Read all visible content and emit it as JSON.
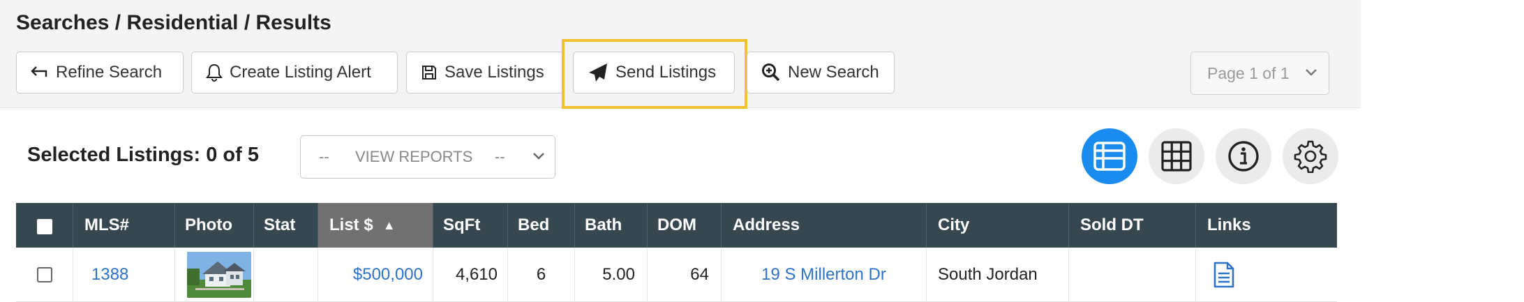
{
  "header": {
    "breadcrumb": "Searches / Residential / Results"
  },
  "toolbar": {
    "refine_label": "Refine Search",
    "alert_label": "Create Listing Alert",
    "save_label": "Save Listings",
    "send_label": "Send Listings",
    "new_label": "New Search",
    "page_label": "Page 1 of 1"
  },
  "selection": {
    "count_label": "Selected Listings: 0 of 5",
    "reports_dash_left": "--",
    "reports_label": "VIEW REPORTS",
    "reports_dash_right": "--"
  },
  "view_buttons": {
    "active": "list-view",
    "icons": [
      "list-icon",
      "grid-icon",
      "info-icon",
      "gear-icon"
    ]
  },
  "colors": {
    "header_bg": "#37474f",
    "sorted_col_bg": "#717171",
    "accent": "#1a8cf0",
    "link": "#2e72c8",
    "highlight": "#f2c12e"
  },
  "table": {
    "columns": {
      "mls": "MLS#",
      "photo": "Photo",
      "stat": "Stat",
      "list": "List $",
      "sort_arrow": "▲",
      "sqft": "SqFt",
      "bed": "Bed",
      "bath": "Bath",
      "dom": "DOM",
      "address": "Address",
      "city": "City",
      "sold": "Sold DT",
      "links": "Links"
    },
    "rows": [
      {
        "mls": "1388",
        "stat": "",
        "list": "$500,000",
        "sqft": "4,610",
        "bed": "6",
        "bath": "5.00",
        "dom": "64",
        "address": "19 S Millerton Dr",
        "city": "South Jordan",
        "sold": ""
      }
    ]
  }
}
